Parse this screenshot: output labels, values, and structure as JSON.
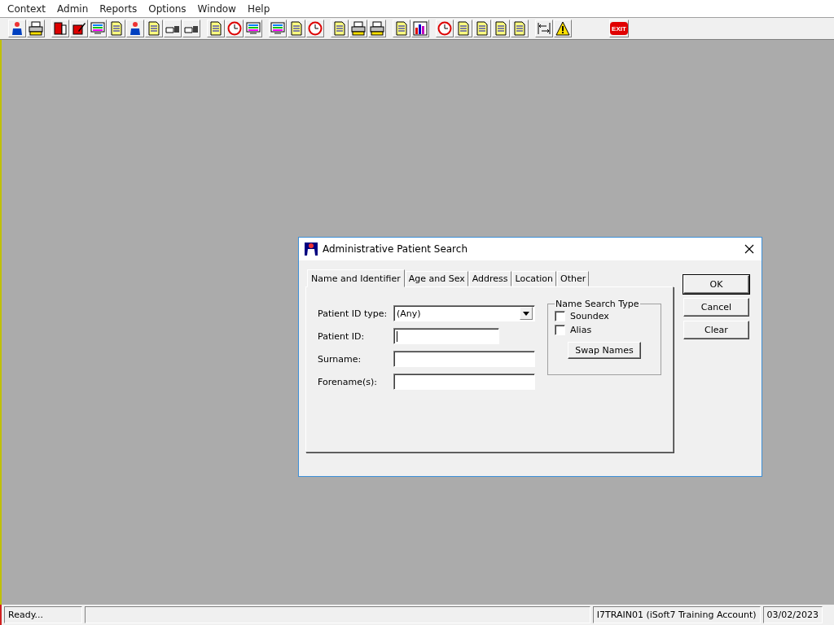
{
  "menu": [
    "Context",
    "Admin",
    "Reports",
    "Options",
    "Window",
    "Help"
  ],
  "toolbar": {
    "exit_label": "EXIT"
  },
  "dialog": {
    "title": "Administrative Patient Search",
    "tabs": [
      {
        "label": "Name and Identifier",
        "selected": true
      },
      {
        "label": "Age and Sex",
        "selected": false
      },
      {
        "label": "Address",
        "selected": false
      },
      {
        "label": "Location",
        "selected": false
      },
      {
        "label": "Other",
        "selected": false
      }
    ],
    "fields": [
      {
        "kind": "dropdown",
        "label": "Patient ID type:",
        "value": "(Any)"
      },
      {
        "kind": "short",
        "label": "Patient ID:",
        "focused": true
      },
      {
        "kind": "text",
        "label": "Surname:"
      },
      {
        "kind": "text",
        "label": "Forename(s):"
      }
    ],
    "name_search_type": {
      "title": "Name Search Type",
      "options": [
        {
          "label": "Soundex",
          "checked": false
        },
        {
          "label": "Alias",
          "checked": false
        }
      ],
      "button": "Swap Names"
    },
    "buttons": [
      "OK",
      "Cancel",
      "Clear"
    ]
  },
  "status_bar": {
    "message": "Ready...",
    "user": "I7TRAIN01 (iSoft7 Training Account)",
    "date": "03/02/2023"
  }
}
